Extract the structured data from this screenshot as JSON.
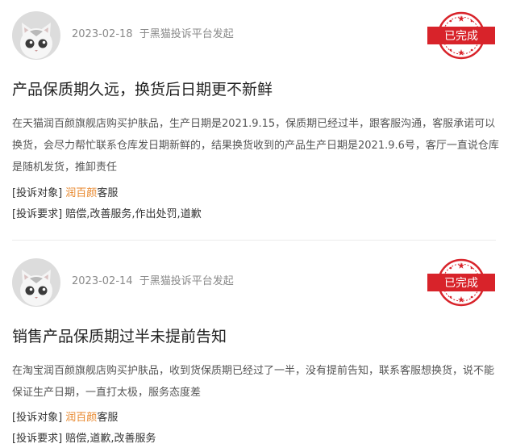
{
  "complaints": [
    {
      "date": "2023-02-18",
      "source": "于黑猫投诉平台发起",
      "status": "已完成",
      "title": "产品保质期久远，换货后日期更不新鲜",
      "description": "在天猫润百颜旗舰店购买护肤品，生产日期是2021.9.15，保质期已经过半，跟客服沟通，客服承诺可以换货，会尽力帮忙联系仓库发日期新鲜的，结果换货收到的产品生产日期是2021.9.6号，客厅一直说仓库是随机发货，推卸责任",
      "target_label": "[投诉对象]",
      "target_merchant": "润百颜",
      "target_suffix": "客服",
      "demand_label": "[投诉要求]",
      "demand": "赔偿,改善服务,作出处罚,道歉"
    },
    {
      "date": "2023-02-14",
      "source": "于黑猫投诉平台发起",
      "status": "已完成",
      "title": "销售产品保质期过半未提前告知",
      "description": "在淘宝润百颜旗舰店购买护肤品，收到货保质期已经过了一半，没有提前告知，联系客服想换货，说不能保证生产日期，一直打太极，服务态度差",
      "target_label": "[投诉对象]",
      "target_merchant": "润百颜",
      "target_suffix": "客服",
      "demand_label": "[投诉要求]",
      "demand": "赔偿,道歉,改善服务"
    }
  ],
  "colors": {
    "stamp_red": "#d8232a",
    "merchant_orange": "#e8862a",
    "meta_gray": "#8a8a8a"
  },
  "icons": {
    "avatar": "cat-avatar-icon",
    "stamp": "completed-stamp-icon"
  }
}
